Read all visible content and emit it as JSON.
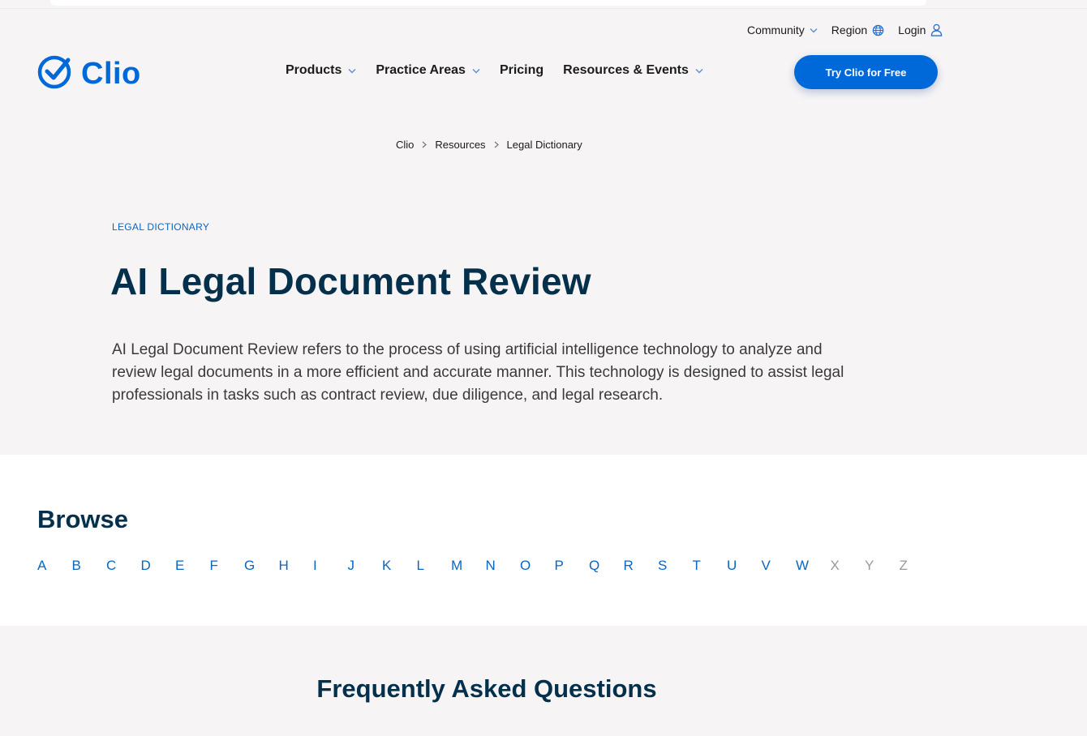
{
  "header": {
    "utility_nav": [
      {
        "label": "Community",
        "icon": "chevron-down-icon"
      },
      {
        "label": "Region",
        "icon": "globe-icon"
      },
      {
        "label": "Login",
        "icon": "user-icon"
      }
    ],
    "logo_text": "Clio",
    "main_nav": [
      {
        "label": "Products",
        "has_dropdown": true
      },
      {
        "label": "Practice Areas",
        "has_dropdown": true
      },
      {
        "label": "Pricing",
        "has_dropdown": false
      },
      {
        "label": "Resources & Events",
        "has_dropdown": true
      }
    ],
    "cta_label": "Try Clio for Free"
  },
  "breadcrumb": [
    "Clio",
    "Resources",
    "Legal Dictionary"
  ],
  "hero": {
    "eyebrow": "LEGAL DICTIONARY",
    "title": "AI Legal Document Review",
    "definition": "AI Legal Document Review refers to the process of using artificial intelligence technology to analyze and review legal documents in a more efficient and accurate manner. This technology is designed to assist legal professionals in tasks such as contract review, due diligence, and legal research."
  },
  "browse": {
    "title": "Browse",
    "letters": [
      "A",
      "B",
      "C",
      "D",
      "E",
      "F",
      "G",
      "H",
      "I",
      "J",
      "K",
      "L",
      "M",
      "N",
      "O",
      "P",
      "Q",
      "R",
      "S",
      "T",
      "U",
      "V",
      "W",
      "X",
      "Y",
      "Z"
    ],
    "disabled_letters": [
      "X",
      "Y",
      "Z"
    ]
  },
  "faq": {
    "title": "Frequently Asked Questions"
  },
  "colors": {
    "brand_blue": "#0069d9",
    "link_blue": "#0a66c2",
    "heading_navy": "#04304c",
    "page_bg": "#f6f4f5"
  }
}
